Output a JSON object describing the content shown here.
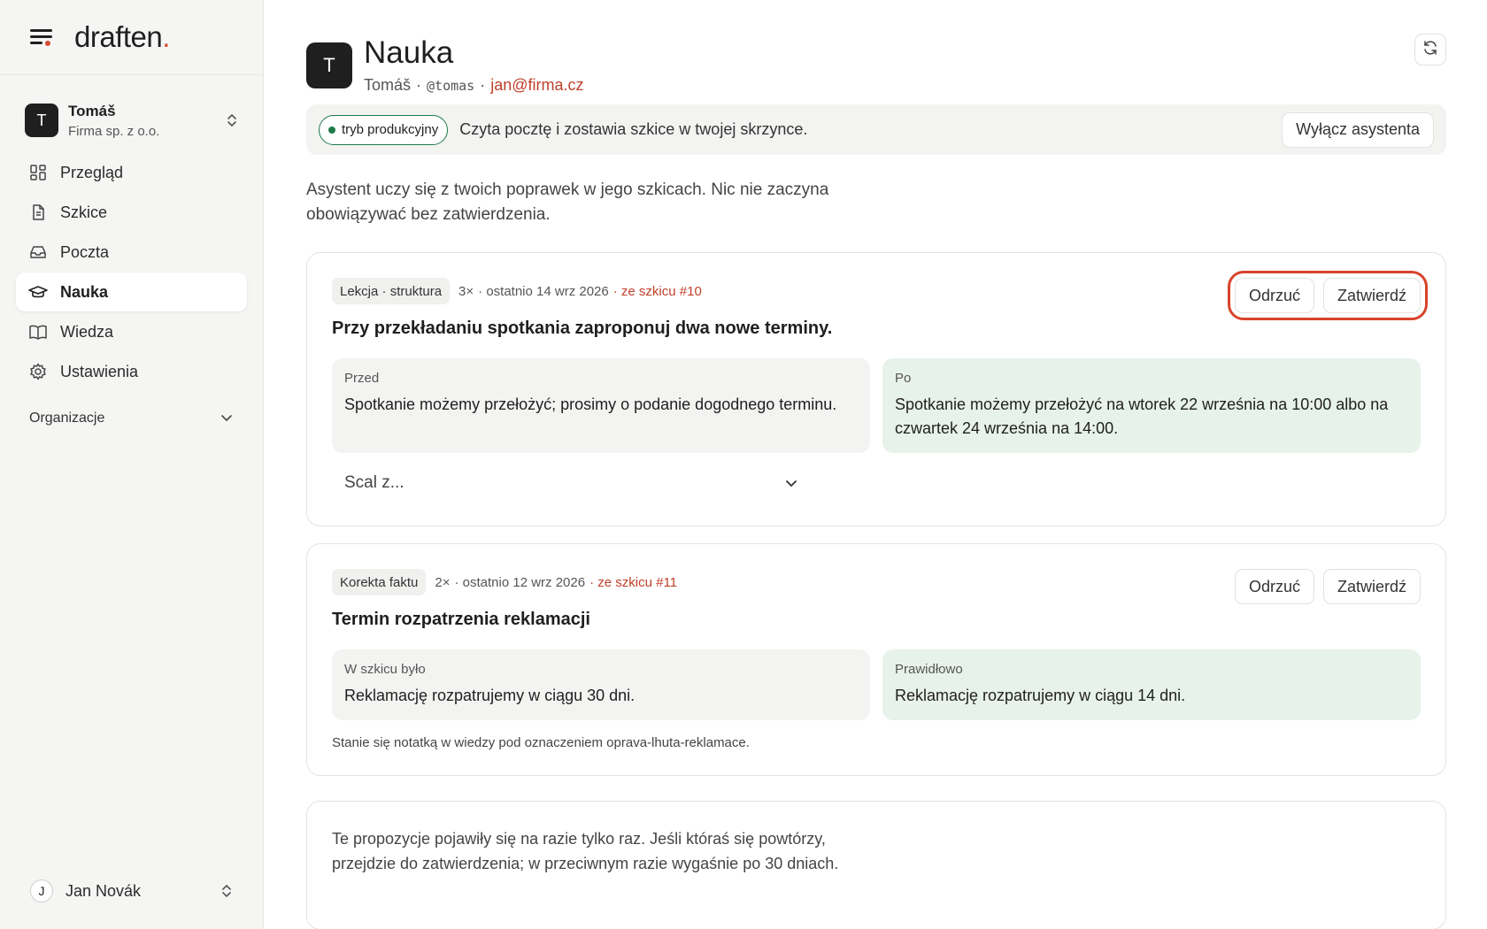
{
  "app": {
    "logo": "draften",
    "logo_dot": "."
  },
  "workspace": {
    "avatar": "T",
    "name": "Tomáš",
    "org": "Firma sp. z o.o."
  },
  "sidebar": {
    "items": [
      {
        "label": "Przegląd",
        "icon": "grid-icon"
      },
      {
        "label": "Szkice",
        "icon": "document-icon"
      },
      {
        "label": "Poczta",
        "icon": "inbox-icon"
      },
      {
        "label": "Nauka",
        "icon": "graduation-cap-icon",
        "active": true
      },
      {
        "label": "Wiedza",
        "icon": "book-icon"
      },
      {
        "label": "Ustawienia",
        "icon": "gear-icon"
      }
    ],
    "section": "Organizacje"
  },
  "user": {
    "avatar": "J",
    "name": "Jan Novák"
  },
  "header": {
    "avatar": "T",
    "title": "Nauka",
    "name": "Tomáš",
    "sep1": "·",
    "handle": "@tomas",
    "sep2": "·",
    "email": "jan@firma.cz"
  },
  "mode": {
    "badge": "tryb produkcyjny",
    "text": "Czyta pocztę i zostawia szkice w twojej skrzynce.",
    "button": "Wyłącz asystenta"
  },
  "intro": "Asystent uczy się z twoich poprawek w jego szkicach. Nic nie zaczyna obowiązywać bez zatwierdzenia.",
  "cards": [
    {
      "tag": "Lekcja · struktura",
      "count": "3×",
      "last": "· ostatnio 14 wrz 2026",
      "source": "· ze szkicu #10",
      "reject": "Odrzuć",
      "approve": "Zatwierdź",
      "title": "Przy przekładaniu spotkania zaproponuj dwa nowe terminy.",
      "before_label": "Przed",
      "before_text": "Spotkanie możemy przełożyć; prosimy o podanie dogodnego terminu.",
      "after_label": "Po",
      "after_text": "Spotkanie możemy przełożyć na wtorek 22 września na 10:00 albo na czwartek 24 września na 14:00.",
      "merge": "Scal z..."
    },
    {
      "tag": "Korekta faktu",
      "count": "2×",
      "last": "· ostatnio 12 wrz 2026",
      "source": "· ze szkicu #11",
      "reject": "Odrzuć",
      "approve": "Zatwierdź",
      "title": "Termin rozpatrzenia reklamacji",
      "before_label": "W szkicu było",
      "before_text": "Reklamację rozpatrujemy w ciągu 30 dni.",
      "after_label": "Prawidłowo",
      "after_text": "Reklamację rozpatrujemy w ciągu 14 dni.",
      "note": "Stanie się notatką w wiedzy pod oznaczeniem oprava-lhuta-reklamace."
    }
  ],
  "pending_note": "Te propozycje pojawiły się na razie tylko raz. Jeśli któraś się powtórzy, przejdzie do zatwierdzenia; w przeciwnym razie wygaśnie po 30 dniach.",
  "colors": {
    "accent": "#d64b33",
    "link": "#c0402a",
    "success": "#1d7a4a",
    "after_bg": "#e7f2ea"
  }
}
